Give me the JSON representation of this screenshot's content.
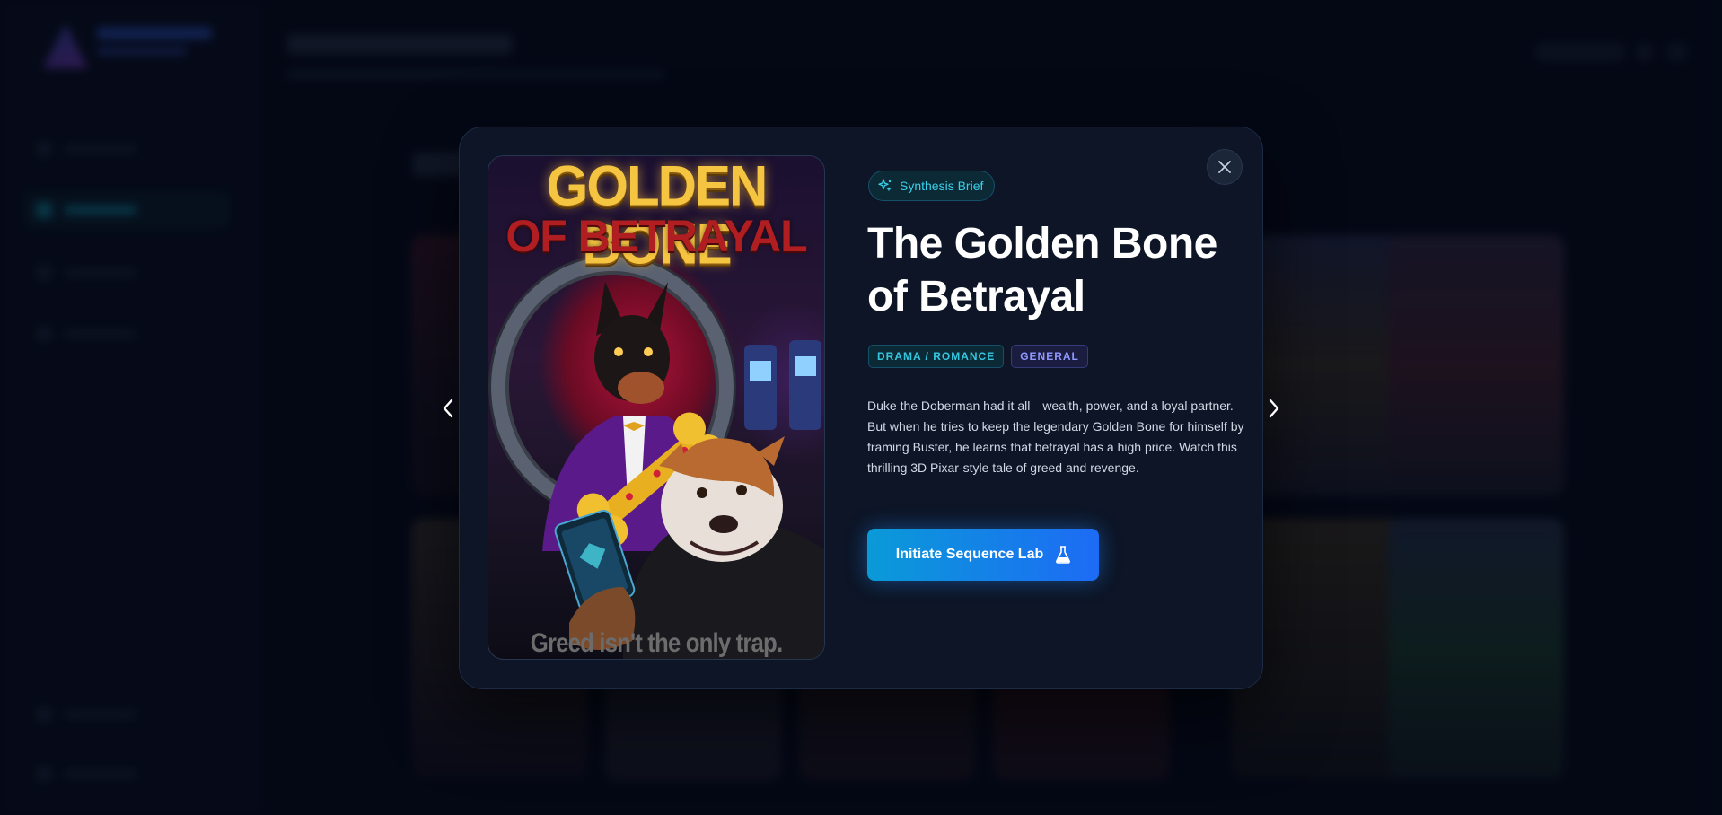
{
  "background_app": {
    "nav_items_count_hint": "sidebar",
    "accent": "#18c0d8"
  },
  "modal": {
    "badge_label": "Synthesis Brief",
    "title": "The Golden Bone of Betrayal",
    "tags": [
      "DRAMA / ROMANCE",
      "GENERAL"
    ],
    "description": "Duke the Doberman had it all—wealth, power, and a loyal partner. But when he tries to keep the legendary Golden Bone for himself by framing Buster, he learns that betrayal has a high price. Watch this thrilling 3D Pixar-style tale of greed and revenge.",
    "cta_label": "Initiate Sequence Lab",
    "poster": {
      "title_line1": "GOLDEN BONE",
      "title_line2": "OF BETRAYAL",
      "tagline": "Greed isn't the only trap."
    }
  },
  "icons": {
    "close": "close-icon",
    "prev": "chevron-left-icon",
    "next": "chevron-right-icon",
    "badge": "sparkles-icon",
    "cta": "flask-icon"
  },
  "colors": {
    "modal_bg": "#0d1526",
    "accent_cyan": "#36c7e0",
    "accent_violet": "#8f98ff",
    "cta_start": "#0a9ad8",
    "cta_end": "#1d6bf5"
  }
}
